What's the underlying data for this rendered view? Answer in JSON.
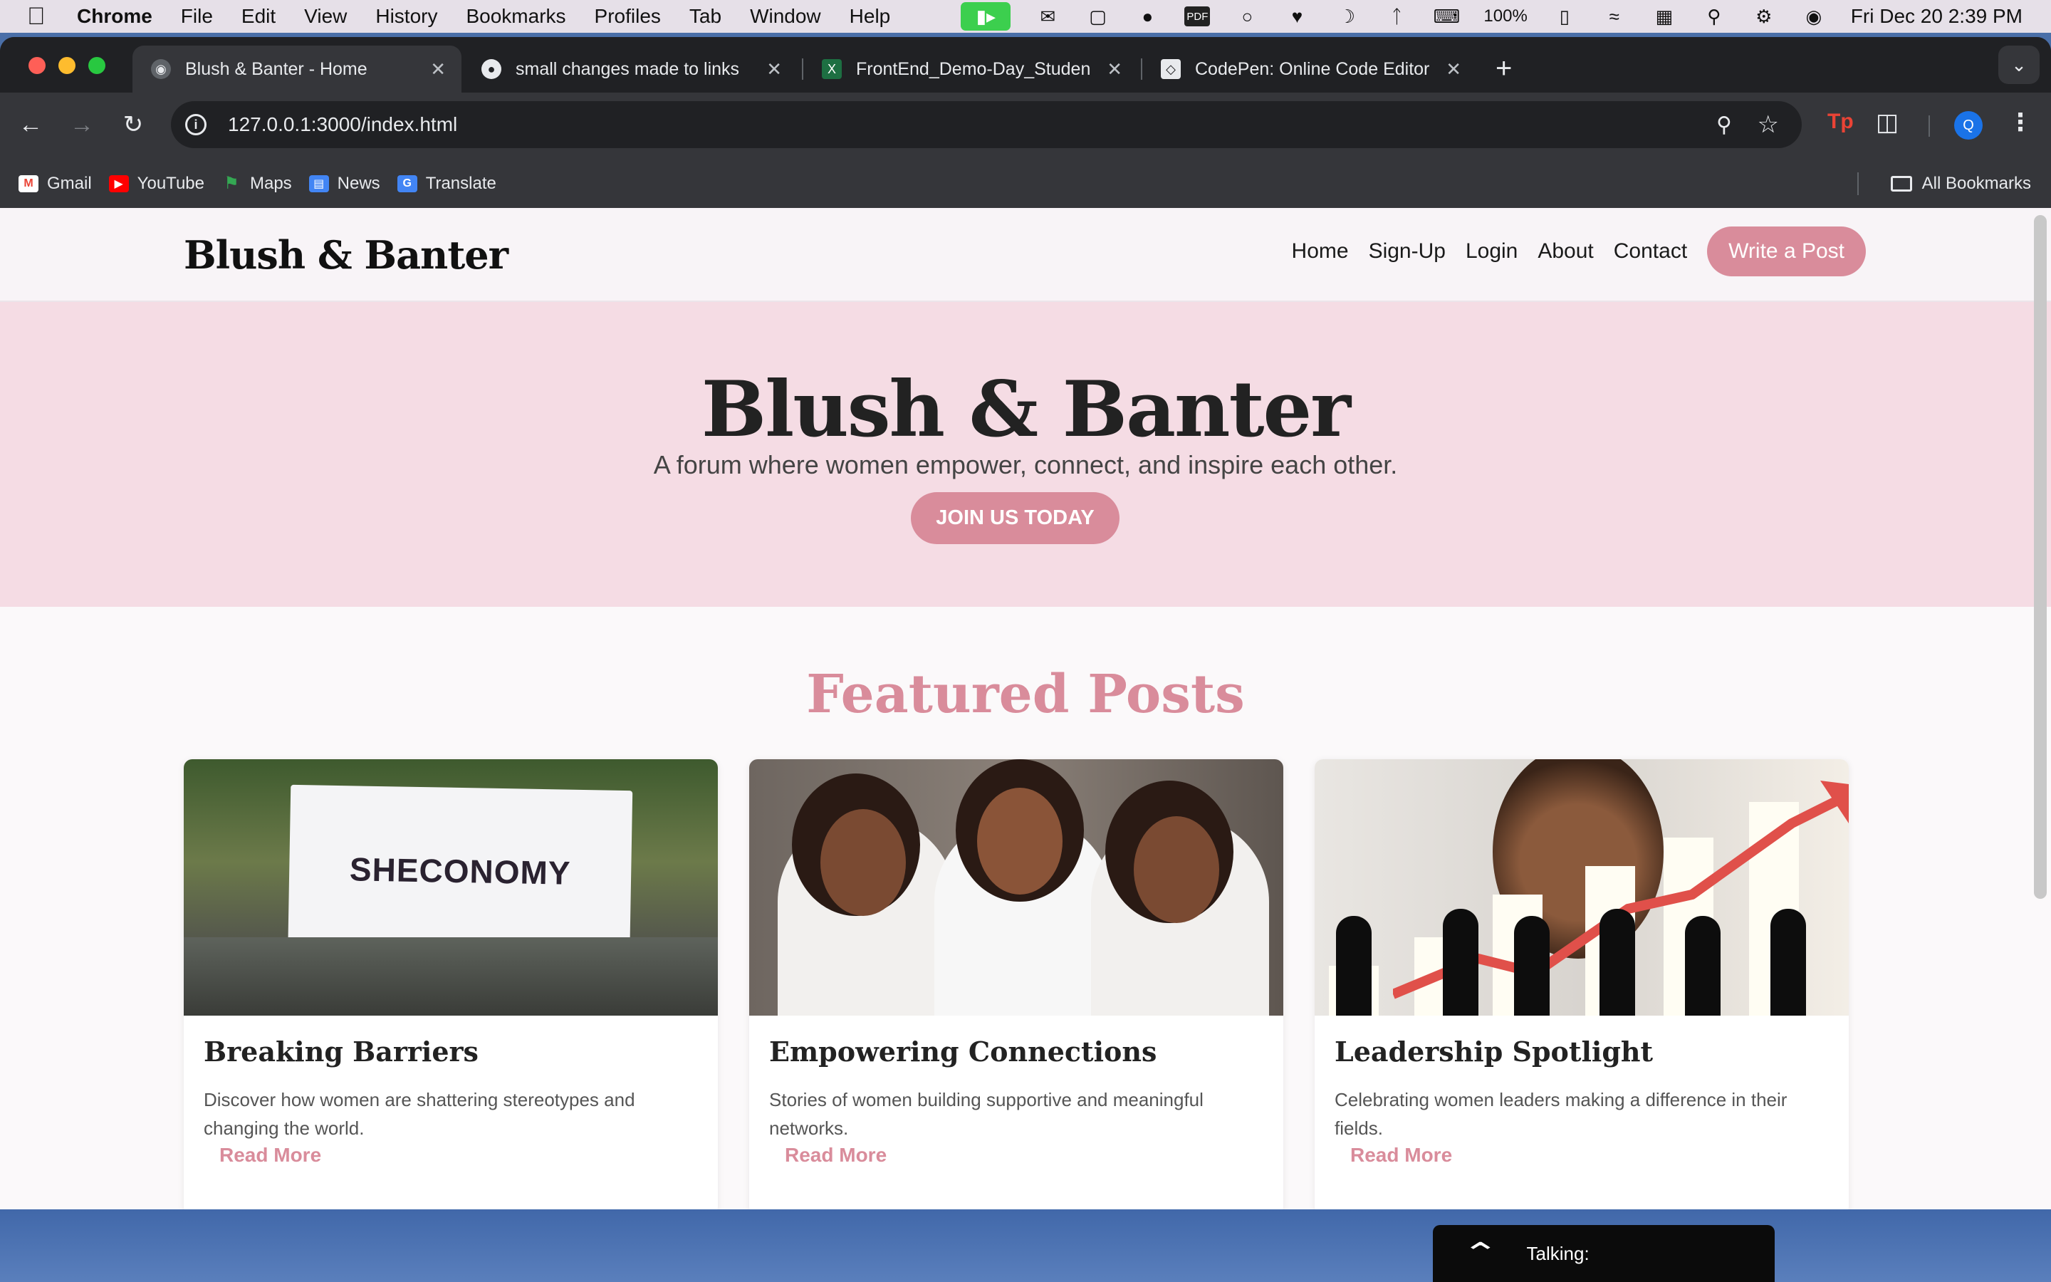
{
  "menubar": {
    "app": "Chrome",
    "menus": [
      "File",
      "Edit",
      "View",
      "History",
      "Bookmarks",
      "Profiles",
      "Tab",
      "Window",
      "Help"
    ],
    "battery": "100%",
    "datetime": "Fri Dec 20  2:39 PM",
    "pdf_label": "PDF"
  },
  "browser": {
    "tabs": [
      {
        "title": "Blush & Banter - Home",
        "favicon": "globe-icon"
      },
      {
        "title": "small changes made to links",
        "favicon": "github-icon"
      },
      {
        "title": "FrontEnd_Demo-Day_Studen",
        "favicon": "excel-icon"
      },
      {
        "title": "CodePen: Online Code Editor",
        "favicon": "codepen-icon"
      }
    ],
    "url": "127.0.0.1:3000/index.html",
    "profile_initial": "Q",
    "bookmarks": [
      "Gmail",
      "YouTube",
      "Maps",
      "News",
      "Translate"
    ],
    "all_bookmarks": "All Bookmarks"
  },
  "site": {
    "logo": "Blush & Banter",
    "nav": [
      "Home",
      "Sign-Up",
      "Login",
      "About",
      "Contact"
    ],
    "write_button": "Write a Post",
    "hero": {
      "title": "Blush & Banter",
      "subtitle": "A forum where women empower, connect, and inspire each other.",
      "cta": "JOIN US TODAY"
    },
    "featured_title": "Featured Posts",
    "posts": [
      {
        "title": "Breaking Barriers",
        "desc": "Discover how women are shattering stereotypes and changing the world.",
        "link": "Read More",
        "image_text": "SHECONOMY"
      },
      {
        "title": "Empowering Connections",
        "desc": "Stories of women building supportive and meaningful networks.",
        "link": "Read More"
      },
      {
        "title": "Leadership Spotlight",
        "desc": "Celebrating women leaders making a difference in their fields.",
        "link": "Read More"
      }
    ],
    "accent": "#d98c9b",
    "hero_bg": "#f5dce4"
  },
  "overlay": {
    "talking_label": "Talking:"
  }
}
